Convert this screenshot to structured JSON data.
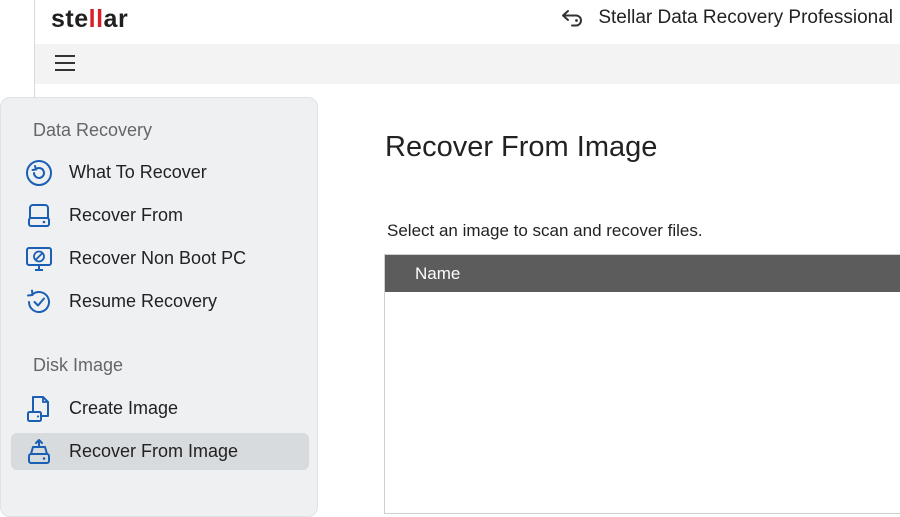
{
  "header": {
    "logo_text": "stellar",
    "logo_pre": "ste",
    "logo_accent": "ll",
    "logo_post": "ar",
    "app_title": "Stellar Data Recovery Professional",
    "back_icon": "undo-arrow-icon"
  },
  "toolbar": {
    "menu_icon": "hamburger-menu-icon"
  },
  "sidebar": {
    "sections": [
      {
        "title": "Data Recovery",
        "items": [
          {
            "label": "What To Recover",
            "icon": "recover-target-icon"
          },
          {
            "label": "Recover From",
            "icon": "drive-icon"
          },
          {
            "label": "Recover Non Boot PC",
            "icon": "monitor-disc-icon"
          },
          {
            "label": "Resume Recovery",
            "icon": "resume-check-icon"
          }
        ]
      },
      {
        "title": "Disk Image",
        "items": [
          {
            "label": "Create Image",
            "icon": "create-image-icon"
          },
          {
            "label": "Recover From Image",
            "icon": "recover-image-icon",
            "active": true
          }
        ]
      }
    ]
  },
  "main": {
    "title": "Recover From Image",
    "instructions": "Select an image to scan and recover files.",
    "table": {
      "columns": [
        "Name"
      ],
      "rows": []
    }
  },
  "colors": {
    "accent_blue": "#1a5fb4",
    "logo_red": "#d91f2b",
    "sidebar_bg": "#eef0f2",
    "active_item_bg": "#d8dbde",
    "table_header_bg": "#5c5c5c"
  }
}
